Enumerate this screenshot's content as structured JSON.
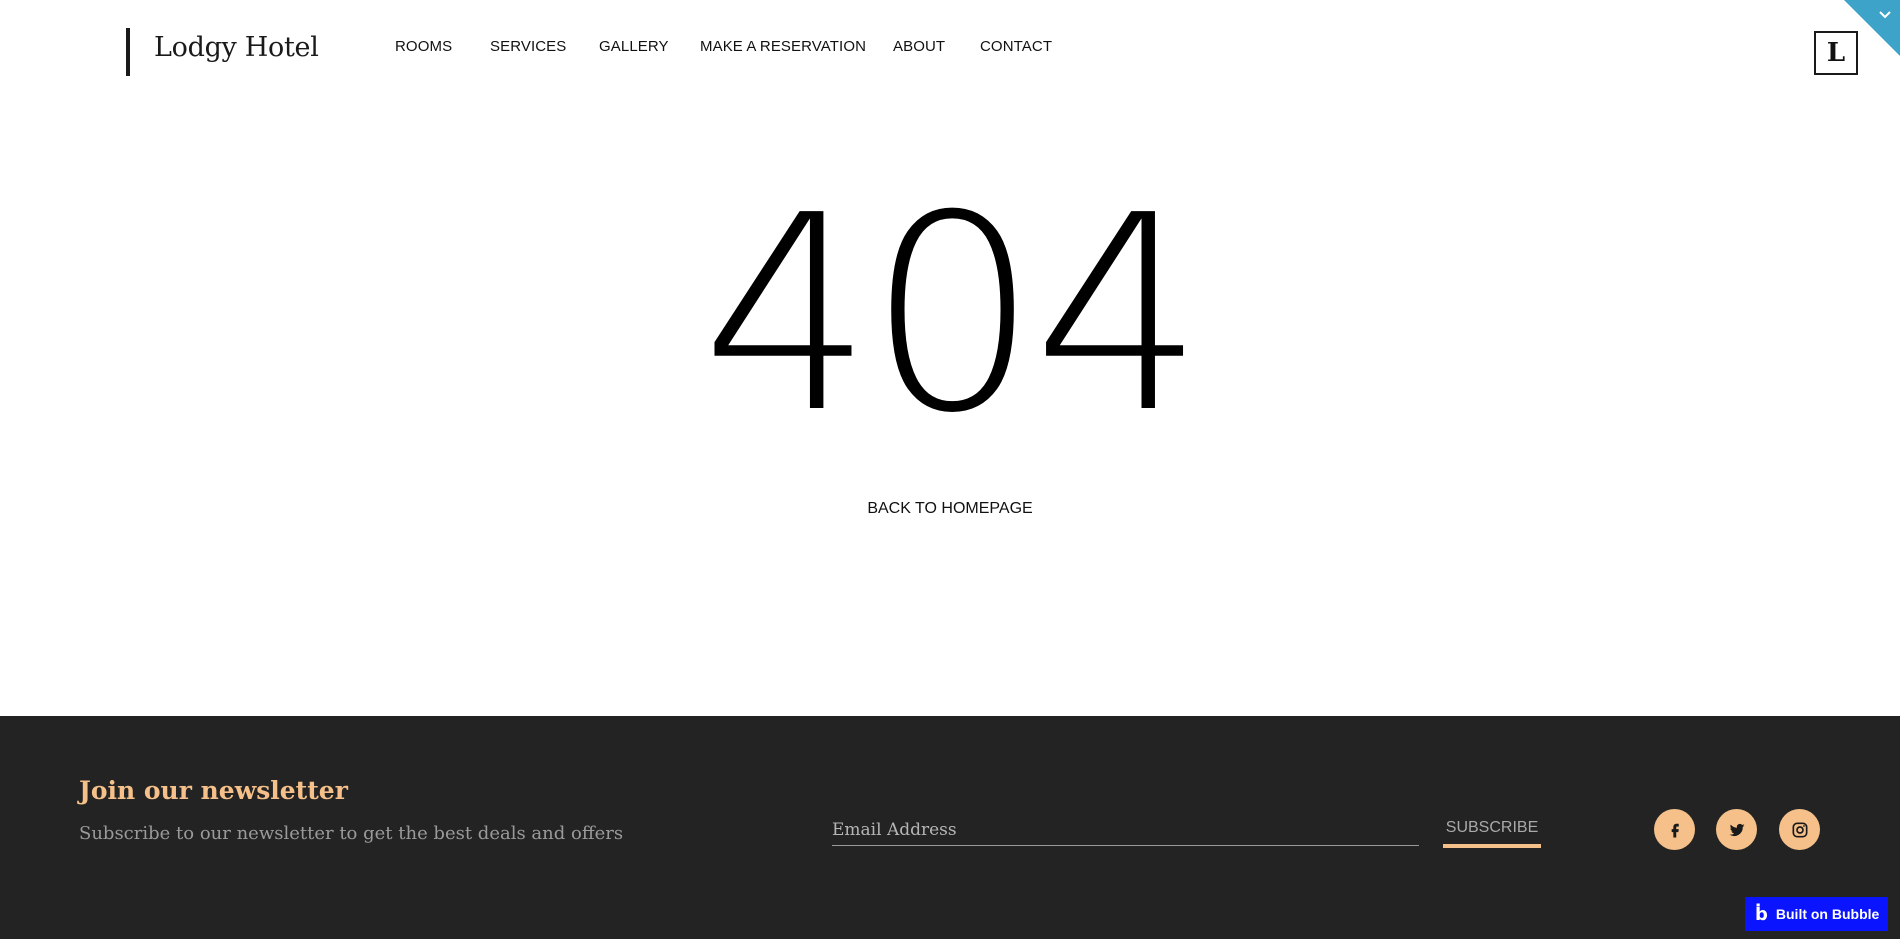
{
  "header": {
    "logo_text": "Lodgy Hotel",
    "nav": [
      {
        "label": "ROOMS"
      },
      {
        "label": "SERVICES"
      },
      {
        "label": "GALLERY"
      },
      {
        "label": "MAKE A RESERVATION"
      },
      {
        "label": "ABOUT"
      },
      {
        "label": "CONTACT"
      }
    ],
    "avatar_letter": "L"
  },
  "main": {
    "error_code": "404",
    "back_link": "BACK TO HOMEPAGE"
  },
  "footer": {
    "newsletter_title": "Join our newsletter",
    "newsletter_subtitle": "Subscribe to our newsletter to get the best deals and offers",
    "email_placeholder": "Email Address",
    "subscribe_label": "SUBSCRIBE",
    "social_icons": [
      "facebook-icon",
      "twitter-icon",
      "instagram-icon"
    ]
  },
  "badge": {
    "label": "Built on Bubble"
  },
  "colors": {
    "accent": "#f5c089",
    "footer_bg": "#232323",
    "corner_blue": "#3ea3c9",
    "badge_blue": "#0a14ff"
  }
}
